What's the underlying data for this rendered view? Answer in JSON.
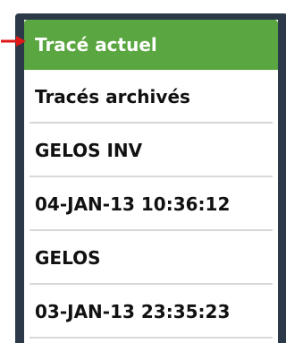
{
  "menu": {
    "items": [
      {
        "label": "Tracé actuel",
        "selected": true
      },
      {
        "label": "Tracés archivés",
        "selected": false
      },
      {
        "label": "GELOS INV",
        "selected": false
      },
      {
        "label": "04-JAN-13 10:36:12",
        "selected": false
      },
      {
        "label": "GELOS",
        "selected": false
      },
      {
        "label": "03-JAN-13 23:35:23",
        "selected": false
      }
    ]
  },
  "colors": {
    "accent_green": "#5aa640",
    "device_frame": "#2c3948",
    "arrow_red": "#e01818",
    "divider": "#d8d8d8"
  },
  "icons": {
    "pointer": "red-arrow-icon"
  }
}
